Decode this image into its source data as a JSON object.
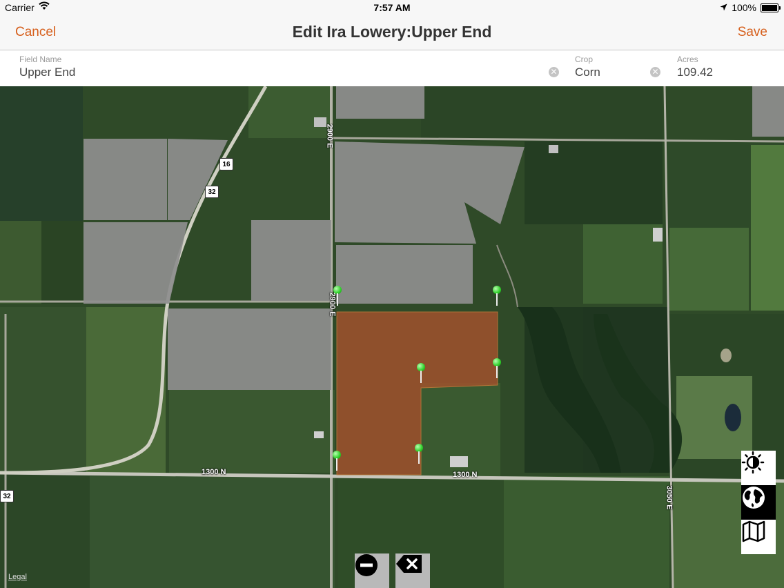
{
  "status": {
    "carrier": "Carrier",
    "time": "7:57 AM",
    "battery": "100%"
  },
  "nav": {
    "cancel": "Cancel",
    "title": "Edit Ira Lowery:Upper End",
    "save": "Save"
  },
  "form": {
    "field_name": {
      "label": "Field Name",
      "value": "Upper End"
    },
    "crop": {
      "label": "Crop",
      "value": "Corn"
    },
    "acres": {
      "label": "Acres",
      "value": "109.42"
    }
  },
  "map": {
    "roads": {
      "r1": "2900 E",
      "r2": "2900 E",
      "r3": "1300 N",
      "r4": "1300 N",
      "r5": "3050 E"
    },
    "shields": {
      "s1": "16",
      "s2": "32",
      "s3": "32"
    },
    "legal": "Legal"
  },
  "icons": {
    "brightness": "brightness-icon",
    "globe": "globe-icon",
    "map": "map-icon",
    "remove": "minus-circle-icon",
    "delete": "backspace-icon",
    "wifi": "wifi-icon",
    "location": "location-arrow-icon",
    "battery": "battery-icon"
  },
  "colors": {
    "accent": "#d65f1c",
    "selected_field": "#a0522d",
    "pin": "#2fcf2a"
  }
}
